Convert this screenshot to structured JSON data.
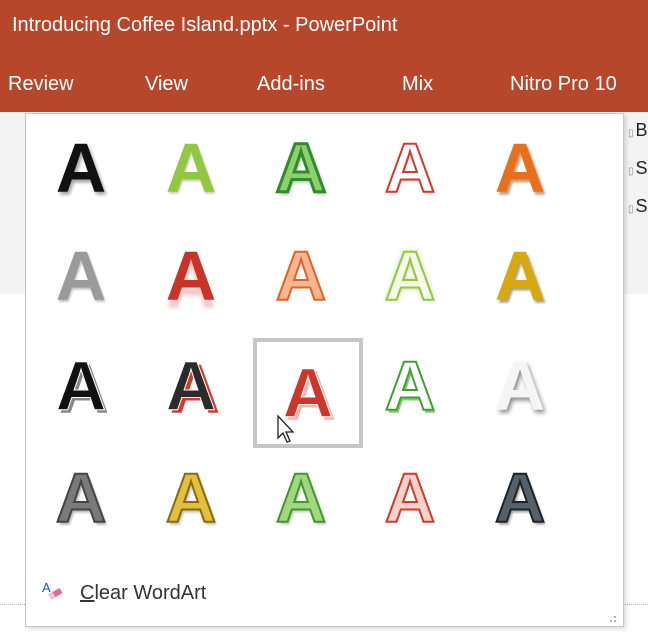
{
  "window": {
    "title": "Introducing Coffee Island.pptx - PowerPoint"
  },
  "ribbon": {
    "tabs": [
      "Review",
      "View",
      "Add-ins",
      "Mix",
      "Nitro Pro 10"
    ],
    "right_items": [
      "B",
      "S",
      "S"
    ]
  },
  "gallery": {
    "glyph": "A",
    "rows": [
      [
        "black-shadow",
        "light-green-gradient",
        "green-outline-bevel",
        "red-outline",
        "orange-bevel"
      ],
      [
        "gray-gradient",
        "red-reflection",
        "orange-soft",
        "light-green-glow",
        "gold-bevel"
      ],
      [
        "black-white-outline",
        "black-red-shadow",
        "red-selected",
        "green-outline",
        "white-gray-shadow"
      ],
      [
        "gray-pattern",
        "gold-pattern",
        "green-pattern",
        "red-pattern",
        "dark-pattern"
      ]
    ],
    "selected": "red-selected"
  },
  "clear": {
    "accel": "C",
    "rest": "lear WordArt",
    "icon": "clear-wordart-icon"
  },
  "colors": {
    "ribbon_accent": "#b7472a",
    "gallery_border": "#c8c8c8",
    "selection_border": "#c6c6c6"
  }
}
